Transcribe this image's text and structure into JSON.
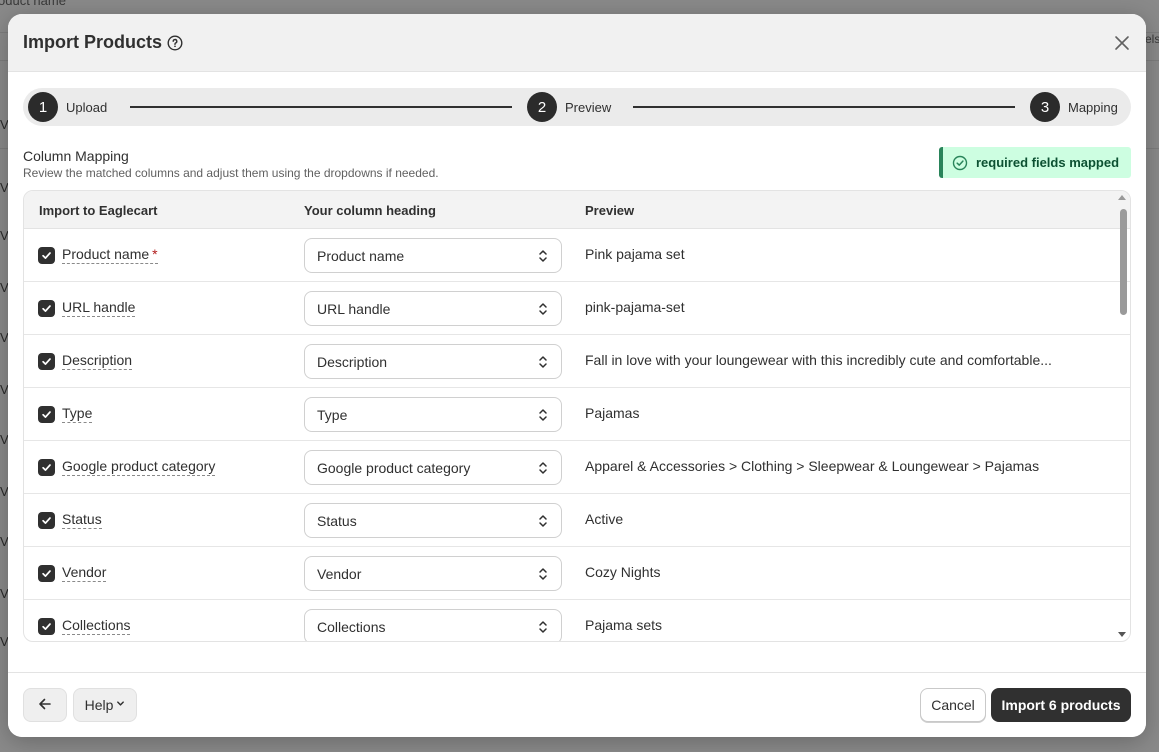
{
  "background": {
    "header_text": "oduct name",
    "right_edge_text": "els",
    "row_letter": "V"
  },
  "modal": {
    "title": "Import Products",
    "title_icon": "help-circle-icon",
    "close_icon": "close-icon"
  },
  "stepper": {
    "steps": [
      {
        "number": "1",
        "label": "Upload"
      },
      {
        "number": "2",
        "label": "Preview"
      },
      {
        "number": "3",
        "label": "Mapping"
      }
    ]
  },
  "section": {
    "title": "Column Mapping",
    "subtitle": "Review the matched columns and adjust them using the dropdowns if needed.",
    "badge": "required fields mapped"
  },
  "table": {
    "headers": [
      "Import to Eaglecart",
      "Your column heading",
      "Preview"
    ],
    "rows": [
      {
        "field": "Product name",
        "required": "*",
        "column": "Product name",
        "preview": "Pink pajama set",
        "checked": true
      },
      {
        "field": "URL handle",
        "required": "",
        "column": "URL handle",
        "preview": "pink-pajama-set",
        "checked": true
      },
      {
        "field": "Description",
        "required": "",
        "column": "Description",
        "preview": "Fall in love with your loungewear with this incredibly cute and comfortable...",
        "checked": true
      },
      {
        "field": "Type",
        "required": "",
        "column": "Type",
        "preview": "Pajamas",
        "checked": true
      },
      {
        "field": "Google product category",
        "required": "",
        "column": "Google product category",
        "preview": "Apparel & Accessories > Clothing > Sleepwear & Loungewear > Pajamas",
        "checked": true
      },
      {
        "field": "Status",
        "required": "",
        "column": "Status",
        "preview": "Active",
        "checked": true
      },
      {
        "field": "Vendor",
        "required": "",
        "column": "Vendor",
        "preview": "Cozy Nights",
        "checked": true
      },
      {
        "field": "Collections",
        "required": "",
        "column": "Collections",
        "preview": "Pajama sets",
        "checked": true
      }
    ]
  },
  "footer": {
    "back_icon": "arrow-left-icon",
    "help_label": "Help",
    "cancel_label": "Cancel",
    "import_label": "Import 6 products"
  },
  "colors": {
    "badge_bg": "#cdfee1",
    "badge_accent": "#29845a",
    "primary_button": "#303030",
    "required_marker": "#b11d1d"
  }
}
